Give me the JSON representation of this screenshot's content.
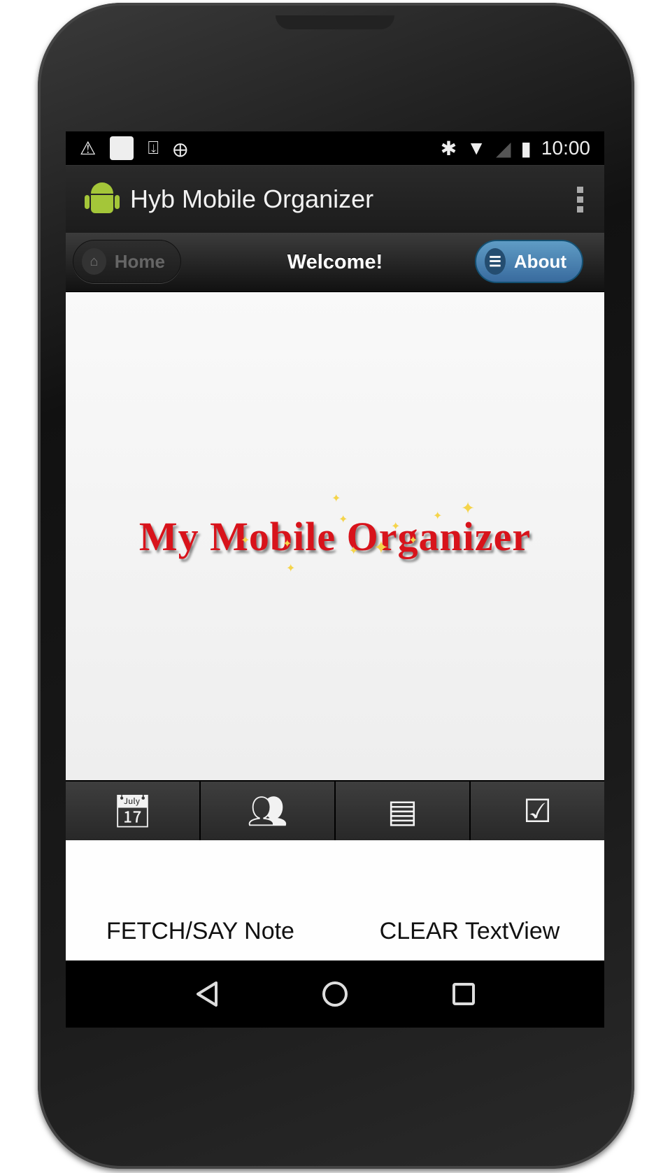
{
  "status_bar": {
    "time": "10:00",
    "left_icons": [
      "warning-icon",
      "notification-icon",
      "download-icon",
      "android-debug-icon"
    ],
    "right_icons": [
      "bluetooth-icon",
      "wifi-icon",
      "signal-icon",
      "battery-charging-icon"
    ]
  },
  "action_bar": {
    "title": "Hyb Mobile Organizer"
  },
  "header": {
    "title": "Welcome!",
    "home_label": "Home",
    "about_label": "About"
  },
  "content": {
    "logo_text": "My Mobile Organizer"
  },
  "navbar": {
    "items": [
      "calendar",
      "contacts",
      "notes",
      "tasks"
    ]
  },
  "buttons": {
    "fetch_label": "FETCH/SAY Note",
    "clear_label": "CLEAR TextView"
  }
}
